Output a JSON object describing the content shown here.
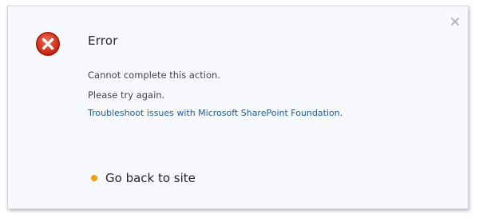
{
  "dialog": {
    "title": "Error",
    "message": "Cannot complete this action.",
    "retry_text": "Please try again.",
    "troubleshoot_link": "Troubleshoot issues with Microsoft SharePoint Foundation.",
    "go_back_label": "Go back to site",
    "close_icon": "close-icon",
    "error_icon": "error-x-circle-icon"
  },
  "colors": {
    "error_red": "#e0301e",
    "link_blue": "#1a5ea6",
    "bullet_orange": "#f39c12",
    "dialog_bg": "#f8f9fd"
  }
}
